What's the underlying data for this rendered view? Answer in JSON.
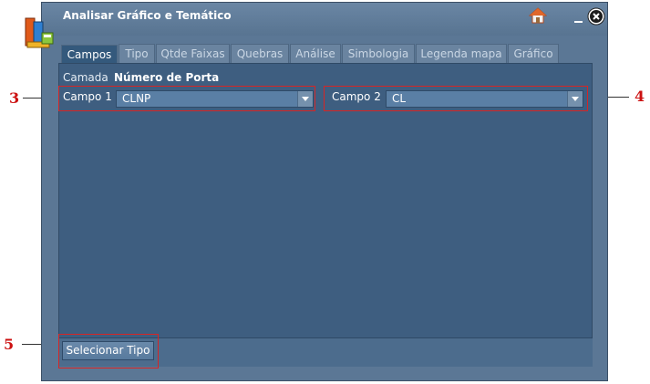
{
  "window": {
    "title": "Analisar Gráfico e Temático",
    "icons": [
      "app-icon",
      "home-icon",
      "minimize-icon",
      "close-icon"
    ]
  },
  "tabs": [
    {
      "label": "Campos",
      "active": true
    },
    {
      "label": "Tipo",
      "active": false
    },
    {
      "label": "Qtde Faixas",
      "active": false
    },
    {
      "label": "Quebras",
      "active": false
    },
    {
      "label": "Análise",
      "active": false
    },
    {
      "label": "Simbologia",
      "active": false
    },
    {
      "label": "Legenda mapa",
      "active": false
    },
    {
      "label": "Gráfico",
      "active": false
    }
  ],
  "form": {
    "camada_label": "Camada",
    "camada_value": "Número de Porta",
    "campo1_label": "Campo 1",
    "campo1_value": "CLNP",
    "campo2_label": "Campo 2",
    "campo2_value": "CL"
  },
  "footer": {
    "button_label": "Selecionar Tipo"
  },
  "callouts": {
    "c3": "3",
    "c4": "4",
    "c5": "5"
  },
  "colors": {
    "window_bg": "#5b7795",
    "panel_bg": "#3e5e80",
    "highlight": "#d62525",
    "callout_text": "#cc1111"
  }
}
